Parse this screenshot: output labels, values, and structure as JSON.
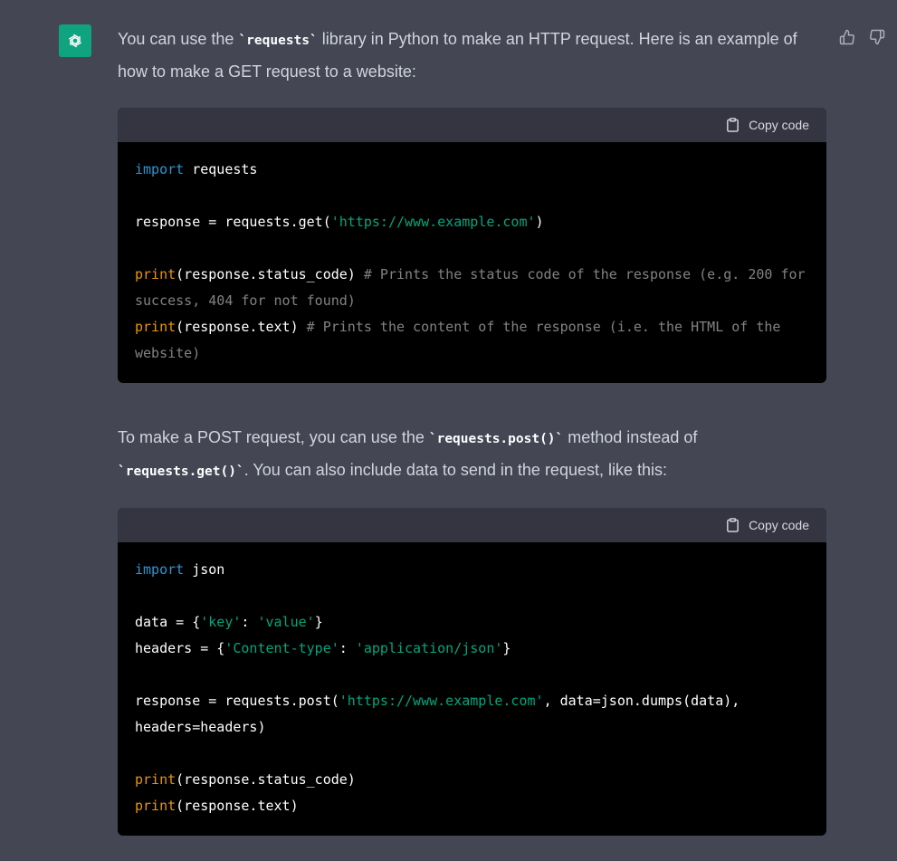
{
  "message": {
    "para1": {
      "before": "You can use the ",
      "code": "`requests`",
      "after": " library in Python to make an HTTP request. Here is an example of how to make a GET request to a website:"
    },
    "para2": {
      "before": "To make a POST request, you can use the ",
      "code1": "`requests.post()`",
      "middle": " method instead of ",
      "code2": "`requests.get()`",
      "after": ". You can also include data to send in the request, like this:"
    }
  },
  "copy_label": "Copy code",
  "code1": {
    "l1_kw": "import",
    "l1_rest": " requests",
    "l3_a": "response = requests.get(",
    "l3_str": "'https://www.example.com'",
    "l3_b": ")",
    "l5_fn": "print",
    "l5_a": "(response.status_code) ",
    "l5_cm": "# Prints the status code of the response (e.g. 200 for success, 404 for not found)",
    "l6_fn": "print",
    "l6_a": "(response.text) ",
    "l6_cm": "# Prints the content of the response (i.e. the HTML of the website)"
  },
  "code2": {
    "l1_kw": "import",
    "l1_rest": " json",
    "l3_a": "data = {",
    "l3_s1": "'key'",
    "l3_b": ": ",
    "l3_s2": "'value'",
    "l3_c": "}",
    "l4_a": "headers = {",
    "l4_s1": "'Content-type'",
    "l4_b": ": ",
    "l4_s2": "'application/json'",
    "l4_c": "}",
    "l6_a": "response = requests.post(",
    "l6_s": "'https://www.example.com'",
    "l6_b": ", data=json.dumps(data), headers=headers)",
    "l8_fn": "print",
    "l8_a": "(response.status_code)",
    "l9_fn": "print",
    "l9_a": "(response.text)"
  },
  "icons": {
    "avatar": "openai-logo-icon",
    "thumbs_up": "thumbs-up-icon",
    "thumbs_down": "thumbs-down-icon",
    "clipboard": "clipboard-icon"
  },
  "colors": {
    "background": "#444654",
    "avatar_bg": "#10a37f",
    "code_bg": "#000000",
    "code_header_bg": "#343541",
    "keyword": "#2e95d3",
    "string": "#00a67d",
    "builtin": "#e9950c"
  }
}
